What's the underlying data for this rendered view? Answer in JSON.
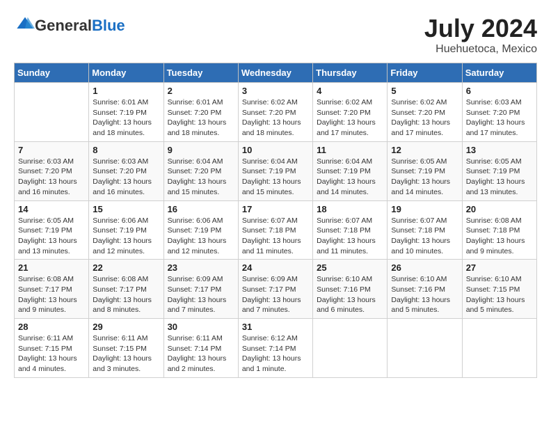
{
  "logo": {
    "general": "General",
    "blue": "Blue"
  },
  "title": "July 2024",
  "subtitle": "Huehuetoca, Mexico",
  "days_of_week": [
    "Sunday",
    "Monday",
    "Tuesday",
    "Wednesday",
    "Thursday",
    "Friday",
    "Saturday"
  ],
  "weeks": [
    [
      {
        "day": "",
        "info": ""
      },
      {
        "day": "1",
        "info": "Sunrise: 6:01 AM\nSunset: 7:19 PM\nDaylight: 13 hours\nand 18 minutes."
      },
      {
        "day": "2",
        "info": "Sunrise: 6:01 AM\nSunset: 7:20 PM\nDaylight: 13 hours\nand 18 minutes."
      },
      {
        "day": "3",
        "info": "Sunrise: 6:02 AM\nSunset: 7:20 PM\nDaylight: 13 hours\nand 18 minutes."
      },
      {
        "day": "4",
        "info": "Sunrise: 6:02 AM\nSunset: 7:20 PM\nDaylight: 13 hours\nand 17 minutes."
      },
      {
        "day": "5",
        "info": "Sunrise: 6:02 AM\nSunset: 7:20 PM\nDaylight: 13 hours\nand 17 minutes."
      },
      {
        "day": "6",
        "info": "Sunrise: 6:03 AM\nSunset: 7:20 PM\nDaylight: 13 hours\nand 17 minutes."
      }
    ],
    [
      {
        "day": "7",
        "info": "Sunrise: 6:03 AM\nSunset: 7:20 PM\nDaylight: 13 hours\nand 16 minutes."
      },
      {
        "day": "8",
        "info": "Sunrise: 6:03 AM\nSunset: 7:20 PM\nDaylight: 13 hours\nand 16 minutes."
      },
      {
        "day": "9",
        "info": "Sunrise: 6:04 AM\nSunset: 7:20 PM\nDaylight: 13 hours\nand 15 minutes."
      },
      {
        "day": "10",
        "info": "Sunrise: 6:04 AM\nSunset: 7:19 PM\nDaylight: 13 hours\nand 15 minutes."
      },
      {
        "day": "11",
        "info": "Sunrise: 6:04 AM\nSunset: 7:19 PM\nDaylight: 13 hours\nand 14 minutes."
      },
      {
        "day": "12",
        "info": "Sunrise: 6:05 AM\nSunset: 7:19 PM\nDaylight: 13 hours\nand 14 minutes."
      },
      {
        "day": "13",
        "info": "Sunrise: 6:05 AM\nSunset: 7:19 PM\nDaylight: 13 hours\nand 13 minutes."
      }
    ],
    [
      {
        "day": "14",
        "info": "Sunrise: 6:05 AM\nSunset: 7:19 PM\nDaylight: 13 hours\nand 13 minutes."
      },
      {
        "day": "15",
        "info": "Sunrise: 6:06 AM\nSunset: 7:19 PM\nDaylight: 13 hours\nand 12 minutes."
      },
      {
        "day": "16",
        "info": "Sunrise: 6:06 AM\nSunset: 7:19 PM\nDaylight: 13 hours\nand 12 minutes."
      },
      {
        "day": "17",
        "info": "Sunrise: 6:07 AM\nSunset: 7:18 PM\nDaylight: 13 hours\nand 11 minutes."
      },
      {
        "day": "18",
        "info": "Sunrise: 6:07 AM\nSunset: 7:18 PM\nDaylight: 13 hours\nand 11 minutes."
      },
      {
        "day": "19",
        "info": "Sunrise: 6:07 AM\nSunset: 7:18 PM\nDaylight: 13 hours\nand 10 minutes."
      },
      {
        "day": "20",
        "info": "Sunrise: 6:08 AM\nSunset: 7:18 PM\nDaylight: 13 hours\nand 9 minutes."
      }
    ],
    [
      {
        "day": "21",
        "info": "Sunrise: 6:08 AM\nSunset: 7:17 PM\nDaylight: 13 hours\nand 9 minutes."
      },
      {
        "day": "22",
        "info": "Sunrise: 6:08 AM\nSunset: 7:17 PM\nDaylight: 13 hours\nand 8 minutes."
      },
      {
        "day": "23",
        "info": "Sunrise: 6:09 AM\nSunset: 7:17 PM\nDaylight: 13 hours\nand 7 minutes."
      },
      {
        "day": "24",
        "info": "Sunrise: 6:09 AM\nSunset: 7:17 PM\nDaylight: 13 hours\nand 7 minutes."
      },
      {
        "day": "25",
        "info": "Sunrise: 6:10 AM\nSunset: 7:16 PM\nDaylight: 13 hours\nand 6 minutes."
      },
      {
        "day": "26",
        "info": "Sunrise: 6:10 AM\nSunset: 7:16 PM\nDaylight: 13 hours\nand 5 minutes."
      },
      {
        "day": "27",
        "info": "Sunrise: 6:10 AM\nSunset: 7:15 PM\nDaylight: 13 hours\nand 5 minutes."
      }
    ],
    [
      {
        "day": "28",
        "info": "Sunrise: 6:11 AM\nSunset: 7:15 PM\nDaylight: 13 hours\nand 4 minutes."
      },
      {
        "day": "29",
        "info": "Sunrise: 6:11 AM\nSunset: 7:15 PM\nDaylight: 13 hours\nand 3 minutes."
      },
      {
        "day": "30",
        "info": "Sunrise: 6:11 AM\nSunset: 7:14 PM\nDaylight: 13 hours\nand 2 minutes."
      },
      {
        "day": "31",
        "info": "Sunrise: 6:12 AM\nSunset: 7:14 PM\nDaylight: 13 hours\nand 1 minute."
      },
      {
        "day": "",
        "info": ""
      },
      {
        "day": "",
        "info": ""
      },
      {
        "day": "",
        "info": ""
      }
    ]
  ]
}
